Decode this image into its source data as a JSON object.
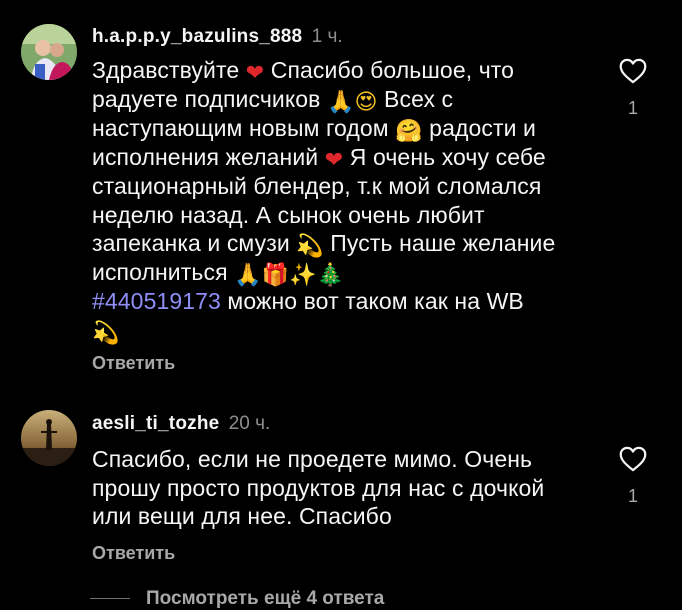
{
  "comments": [
    {
      "username": "h.a.p.p.y_bazulins_888",
      "time": "1 ч.",
      "likes": "1",
      "reply_label": "Ответить",
      "parts": {
        "p1": "Здравствуйте ",
        "e1": "❤",
        "p2": " Спасибо большое, что радуете подписчиков ",
        "e2": "🙏",
        "e3": "😍",
        "p3": " Всех с наступающим новым годом ",
        "e4": "🤗",
        "p4": "  радости и исполнения желаний ",
        "e5": "❤",
        "p5": " Я очень хочу себе стационарный блендер, т.к мой сломался неделю назад.  А сынок очень любит запеканка и смузи ",
        "e6": "💫",
        "p6": " Пусть наше желание исполниться ",
        "e7": "🙏",
        "e8": "🎁",
        "e9": "✨",
        "e10": "🎄",
        "hashtag": "#440519173",
        "p7": "  можно вот таком как на WB ",
        "e11": "💫"
      }
    },
    {
      "username": "aesli_ti_tozhe",
      "time": "20 ч.",
      "likes": "1",
      "reply_label": "Ответить",
      "text": "Спасибо, если не проедете мимо. Очень прошу просто продуктов для нас с дочкой или вещи для нее. Спасибо"
    }
  ],
  "view_replies": "Посмотреть ещё 4 ответа",
  "icons": {
    "like": "heart-outline-icon"
  },
  "colors": {
    "background": "#000000",
    "text": "#f5f5f5",
    "secondary": "#8e8e8e",
    "hashtag": "#8f8ef7"
  }
}
